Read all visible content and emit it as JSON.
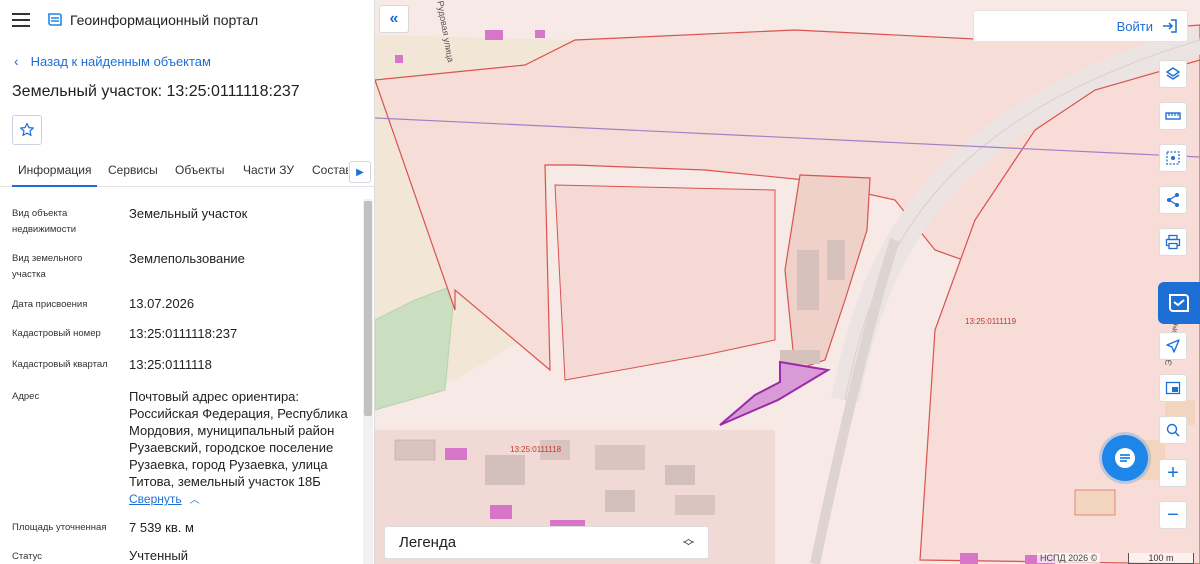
{
  "app": {
    "title": "Геоинформационный портал"
  },
  "nav": {
    "back_label": "Назад к найденным объектам"
  },
  "object": {
    "title": "Земельный участок: 13:25:0111118:237"
  },
  "tabs": [
    {
      "label": "Информация"
    },
    {
      "label": "Сервисы"
    },
    {
      "label": "Объекты"
    },
    {
      "label": "Части ЗУ"
    },
    {
      "label": "Состав"
    }
  ],
  "properties": [
    {
      "label": "Вид объекта недвижимости",
      "value": "Земельный участок"
    },
    {
      "label": "Вид земельного участка",
      "value": "Землепользование"
    },
    {
      "label": "Дата присвоения",
      "value": "13.07.2026"
    },
    {
      "label": "Кадастровый номер",
      "value": "13:25:0111118:237"
    },
    {
      "label": "Кадастровый квартал",
      "value": "13:25:0111118"
    },
    {
      "label": "Адрес",
      "value": "Почтовый адрес ориентира: Российская Федерация, Республика Мордовия, муниципальный район Рузаевский, городское поселение Рузаевка, город Рузаевка, улица Титова, земельный участок 18Б"
    },
    {
      "label": "Площадь уточненная",
      "value": "7 539 кв. м"
    },
    {
      "label": "Статус",
      "value": "Учтенный"
    }
  ],
  "collapse_label": "Свернуть",
  "map": {
    "login_label": "Войти",
    "legend_label": "Легенда",
    "quarter_labels": [
      "13:25:0111119",
      "13:25:0111118"
    ],
    "street_top": "Рудовая улица",
    "street_right": "Энергетическ... ица",
    "attribution": "НСПД 2026 ©",
    "scale": "100 m"
  },
  "colors": {
    "accent": "#1d6fd6",
    "parcel_border": "#d9534f",
    "selected_parcel": "#c86fc9"
  }
}
